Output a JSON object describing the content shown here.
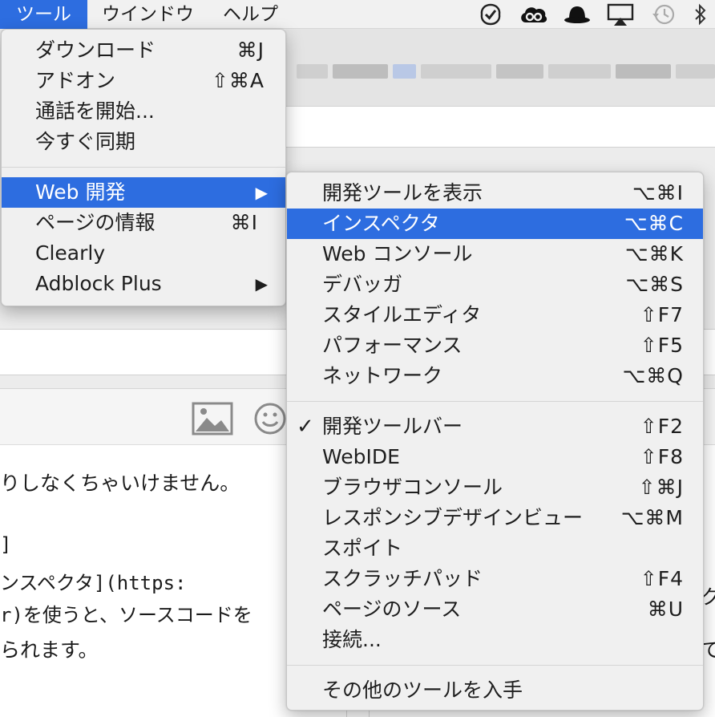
{
  "menubar": {
    "items": [
      {
        "label": "ツール",
        "active": true
      },
      {
        "label": "ウインドウ",
        "active": false
      },
      {
        "label": "ヘルプ",
        "active": false
      }
    ],
    "tray_icons": [
      "checklist-icon",
      "creative-cloud-icon",
      "bowler-hat-icon",
      "airplay-icon",
      "time-machine-icon",
      "bluetooth-icon"
    ]
  },
  "tools_menu": {
    "groups": [
      [
        {
          "label": "ダウンロード",
          "shortcut": "⌘J"
        },
        {
          "label": "アドオン",
          "shortcut": "⇧⌘A"
        },
        {
          "label": "通話を開始...",
          "shortcut": ""
        },
        {
          "label": "今すぐ同期",
          "shortcut": ""
        }
      ],
      [
        {
          "label": "Web 開発",
          "shortcut": "",
          "submenu": true,
          "highlighted": true
        },
        {
          "label": "ページの情報",
          "shortcut": "⌘I"
        },
        {
          "label": "Clearly",
          "shortcut": ""
        },
        {
          "label": "Adblock Plus",
          "shortcut": "",
          "submenu": true
        }
      ]
    ]
  },
  "webdev_menu": {
    "groups": [
      [
        {
          "label": "開発ツールを表示",
          "shortcut": "⌥⌘I"
        },
        {
          "label": "インスペクタ",
          "shortcut": "⌥⌘C",
          "highlighted": true
        },
        {
          "label": "Web コンソール",
          "shortcut": "⌥⌘K"
        },
        {
          "label": "デバッガ",
          "shortcut": "⌥⌘S"
        },
        {
          "label": "スタイルエディタ",
          "shortcut": "⇧F7"
        },
        {
          "label": "パフォーマンス",
          "shortcut": "⇧F5"
        },
        {
          "label": "ネットワーク",
          "shortcut": "⌥⌘Q"
        }
      ],
      [
        {
          "label": "開発ツールバー",
          "shortcut": "⇧F2",
          "checked": true
        },
        {
          "label": "WebIDE",
          "shortcut": "⇧F8"
        },
        {
          "label": "ブラウザコンソール",
          "shortcut": "⇧⌘J"
        },
        {
          "label": "レスポンシブデザインビュー",
          "shortcut": "⌥⌘M"
        },
        {
          "label": "スポイト",
          "shortcut": ""
        },
        {
          "label": "スクラッチパッド",
          "shortcut": "⇧F4"
        },
        {
          "label": "ページのソース",
          "shortcut": "⌘U"
        },
        {
          "label": "接続...",
          "shortcut": ""
        }
      ],
      [
        {
          "label": "その他のツールを入手",
          "shortcut": ""
        }
      ]
    ]
  },
  "background": {
    "content_lines": [
      "りしなくちゃいけません。",
      "]",
      "ンスペクタ](https:",
      "r)を使うと、ソースコードを",
      "られます。"
    ],
    "right_edge_glyphs": [
      "ク",
      "て"
    ]
  },
  "colors": {
    "highlight": "#2d6de0",
    "menu_bg": "#f0f0f0",
    "menubar_bg": "#f1f1f1"
  }
}
